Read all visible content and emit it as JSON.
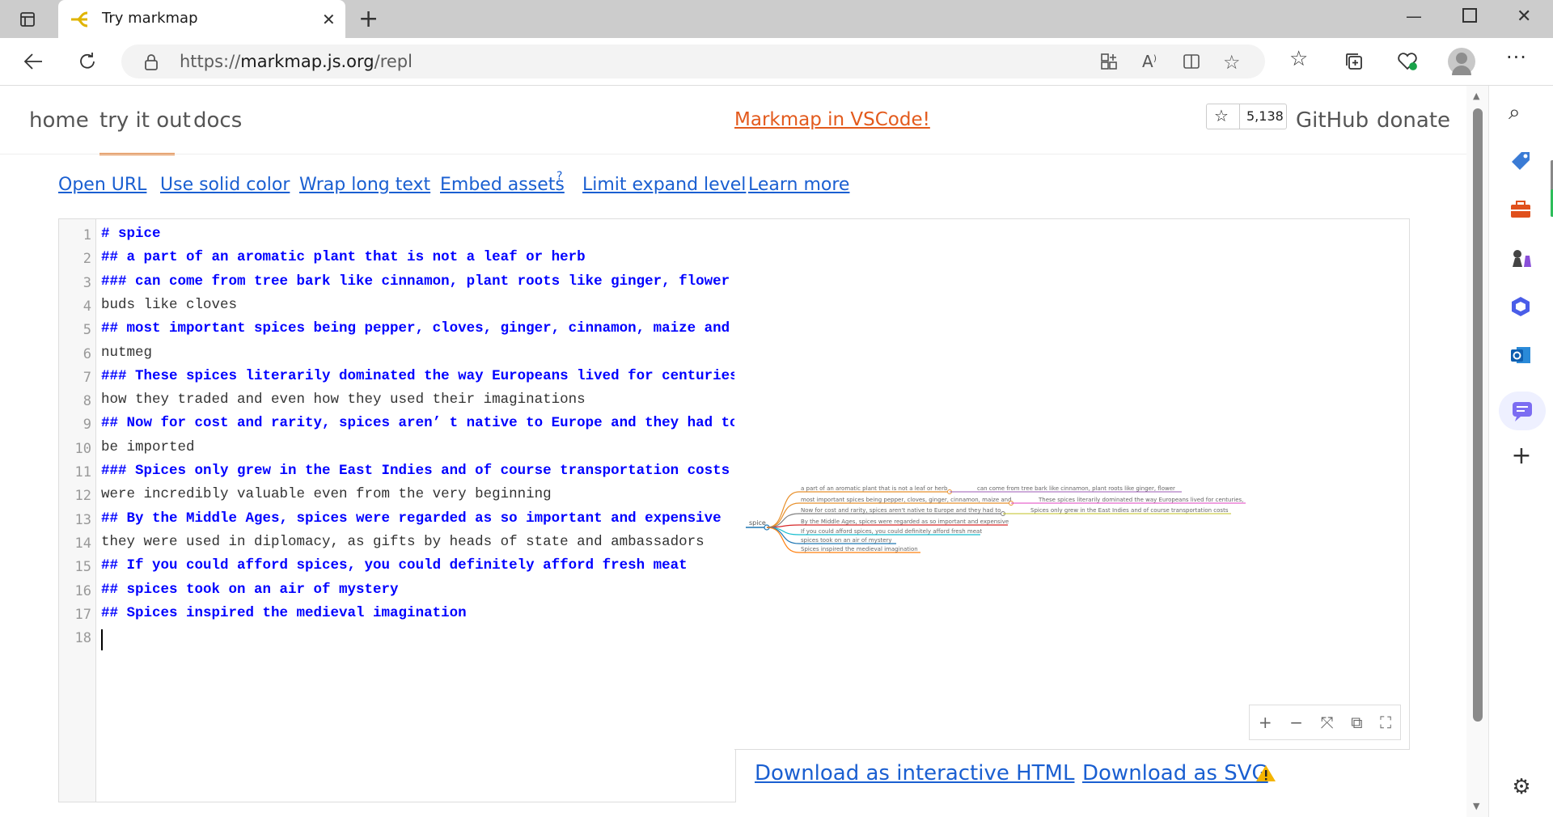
{
  "browser": {
    "tab_title": "Try markmap",
    "url_scheme": "https://",
    "url_host": "markmap.js.org",
    "url_path": "/repl"
  },
  "nav": {
    "home": "home",
    "try": "try it out",
    "docs": "docs",
    "promo": "Markmap in VSCode!",
    "star_count": "5,138",
    "github": "GitHub",
    "donate": "donate"
  },
  "links": {
    "open_url": "Open URL",
    "solid_color": "Use solid color",
    "wrap": "Wrap long text",
    "embed": "Embed assets",
    "embed_sup": "?",
    "limit": "Limit expand level",
    "learn": "Learn more"
  },
  "editor": {
    "lines": [
      {
        "n": "1",
        "text": "# spice",
        "heading": true
      },
      {
        "n": "2",
        "text": "## a part of an aromatic plant that is not a leaf or herb",
        "heading": true
      },
      {
        "n": "3",
        "text": "### can come from tree bark like cinnamon, plant roots like ginger, flower",
        "heading": true
      },
      {
        "n": "4",
        "text": "buds like cloves",
        "heading": false
      },
      {
        "n": "5",
        "text": "## most important spices being pepper, cloves, ginger, cinnamon, maize and",
        "heading": true
      },
      {
        "n": "6",
        "text": "nutmeg",
        "heading": false
      },
      {
        "n": "7",
        "text": "### These spices literarily dominated the way Europeans lived for centuries,",
        "heading": true
      },
      {
        "n": "8",
        "text": "how they traded and even how they used their imaginations",
        "heading": false
      },
      {
        "n": "9",
        "text": "## Now for cost and rarity, spices aren’ t native to Europe and they had to",
        "heading": true
      },
      {
        "n": "10",
        "text": "be imported",
        "heading": false
      },
      {
        "n": "11",
        "text": "### Spices only grew in the East Indies and of course transportation costs",
        "heading": true
      },
      {
        "n": "12",
        "text": "were incredibly valuable even from the very beginning",
        "heading": false
      },
      {
        "n": "13",
        "text": "## By the Middle Ages, spices were regarded as so important and expensive",
        "heading": true
      },
      {
        "n": "14",
        "text": "they were used in diplomacy, as gifts by heads of state and ambassadors",
        "heading": false
      },
      {
        "n": "15",
        "text": "## If you could afford spices, you could definitely afford fresh meat",
        "heading": true
      },
      {
        "n": "16",
        "text": "## spices took on an air of mystery",
        "heading": true
      },
      {
        "n": "17",
        "text": "## Spices inspired the medieval imagination",
        "heading": true
      },
      {
        "n": "18",
        "text": "",
        "heading": false
      }
    ]
  },
  "mindmap": {
    "root": "spice",
    "nodes": [
      {
        "label": "a part of an aromatic plant that is not a leaf or herb",
        "color": "#e8912d",
        "child": "can come from tree bark like cinnamon, plant roots like ginger, flower",
        "child_color": "#9b59b6"
      },
      {
        "label": "most important spices being pepper, cloves, ginger, cinnamon, maize and",
        "color": "#e8912d",
        "child": "These spices literarily dominated the way Europeans lived for centuries,",
        "child_color": "#e040c0"
      },
      {
        "label": "Now for cost and rarity, spices aren't native to Europe and they had to",
        "color": "#7f7f7f",
        "child": "Spices only grew in the East Indies and of course transportation costs",
        "child_color": "#c0c020"
      },
      {
        "label": "By the Middle Ages, spices were regarded as so important and expensive",
        "color": "#d62728",
        "child": "",
        "child_color": ""
      },
      {
        "label": "If you could afford spices, you could definitely afford fresh meat",
        "color": "#17becf",
        "child": "",
        "child_color": ""
      },
      {
        "label": "spices took on an air of mystery",
        "color": "#1f77b4",
        "child": "",
        "child_color": ""
      },
      {
        "label": "Spices inspired the medieval imagination",
        "color": "#ff7f0e",
        "child": "",
        "child_color": ""
      }
    ]
  },
  "zoom": {
    "in": "+",
    "out": "−",
    "fit": "⤧",
    "reset": "⧉",
    "fullscreen": "⛶"
  },
  "downloads": {
    "html": "Download as interactive HTML",
    "svg": "Download as SVG"
  }
}
